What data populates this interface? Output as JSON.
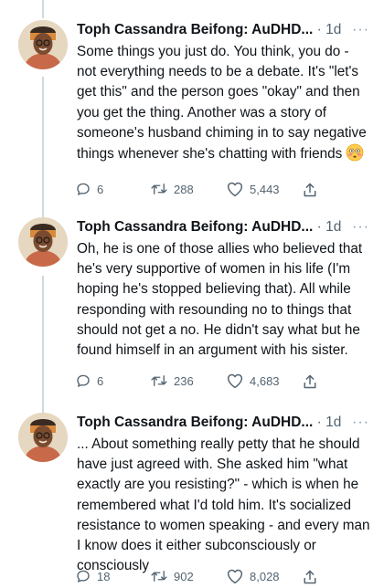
{
  "tweets": [
    {
      "author": "Toph Cassandra Beifong: AuDHD...",
      "time": "· 1d",
      "more": "···",
      "text": "Some things you just do. You think, you do - not everything needs to be a debate. It's \"let's get this\" and the person goes \"okay\" and then you get the thing. Another was a story of someone's husband chiming in to say negative things whenever she's chatting with friends",
      "emoji": "flushed-face",
      "replies": "6",
      "retweets": "288",
      "likes": "5,443"
    },
    {
      "author": "Toph Cassandra Beifong: AuDHD...",
      "time": "· 1d",
      "more": "···",
      "text": "Oh, he is one of those allies who believed that he's very supportive of women in his life (I'm hoping he's stopped believing that). All while responding with resounding no to things that should not get a no. He didn't say what but he found himself in an argument with his sister.",
      "replies": "6",
      "retweets": "236",
      "likes": "4,683"
    },
    {
      "author": "Toph Cassandra Beifong: AuDHD...",
      "time": "· 1d",
      "more": "···",
      "text": "... About something really petty that he should have just agreed with. She asked him \"what exactly are you resisting?\" - which is when he remembered what I'd told him. It's socialized resistance to women speaking - and every man I know does it either subconsciously or consciously",
      "replies": "18",
      "retweets": "902",
      "likes": "8,028"
    }
  ],
  "colors": {
    "text": "#0f1419",
    "secondary": "#536471",
    "thread_line": "#cfd9de"
  }
}
